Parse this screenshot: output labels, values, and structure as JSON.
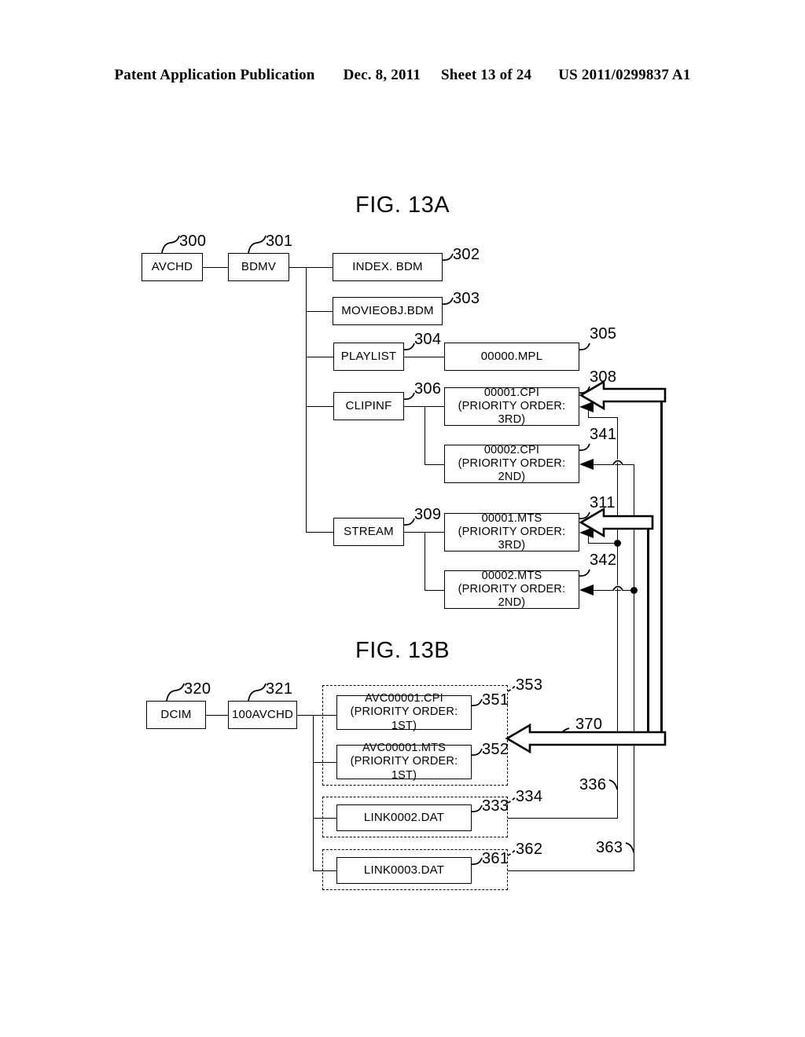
{
  "header": {
    "publication": "Patent Application Publication",
    "date": "Dec. 8, 2011",
    "sheet": "Sheet 13 of 24",
    "docnum": "US 2011/0299837 A1"
  },
  "figures": [
    {
      "id": "fig-13a",
      "title": "FIG. 13A"
    },
    {
      "id": "fig-13b",
      "title": "FIG. 13B"
    }
  ],
  "fig13a": {
    "title": "FIG. 13A",
    "nodes": [
      {
        "key": "avchd",
        "label": "AVCHD",
        "ref": "300"
      },
      {
        "key": "bdmv",
        "label": "BDMV",
        "ref": "301"
      },
      {
        "key": "index",
        "label": "INDEX. BDM",
        "ref": "302"
      },
      {
        "key": "movieobj",
        "label": "MOVIEOBJ.BDM",
        "ref": "303"
      },
      {
        "key": "playlist",
        "label": "PLAYLIST",
        "ref": "304"
      },
      {
        "key": "mpl",
        "label": "00000.MPL",
        "ref": "305"
      },
      {
        "key": "clipinf",
        "label": "CLIPINF",
        "ref": "306"
      },
      {
        "key": "cpi1",
        "label": "00001.CPI",
        "sub": "(PRIORITY ORDER: 3RD)",
        "ref": "308"
      },
      {
        "key": "cpi2",
        "label": "00002.CPI",
        "sub": "(PRIORITY ORDER: 2ND)",
        "ref": "341"
      },
      {
        "key": "stream",
        "label": "STREAM",
        "ref": "309"
      },
      {
        "key": "mts1",
        "label": "00001.MTS",
        "sub": "(PRIORITY ORDER: 3RD)",
        "ref": "311"
      },
      {
        "key": "mts2",
        "label": "00002.MTS",
        "sub": "(PRIORITY ORDER: 2ND)",
        "ref": "342"
      }
    ]
  },
  "fig13b": {
    "title": "FIG. 13B",
    "nodes": [
      {
        "key": "dcim",
        "label": "DCIM",
        "ref": "320"
      },
      {
        "key": "avchd100",
        "label": "100AVCHD",
        "ref": "321"
      },
      {
        "key": "avccpi",
        "label": "AVC00001.CPI",
        "sub": "(PRIORITY ORDER: 1ST)",
        "ref": "351"
      },
      {
        "key": "avcmts",
        "label": "AVC00001.MTS",
        "sub": "(PRIORITY ORDER: 1ST)",
        "ref": "352"
      },
      {
        "key": "link2",
        "label": "LINK0002.DAT",
        "ref": "333"
      },
      {
        "key": "link3",
        "label": "LINK0003.DAT",
        "ref": "361"
      }
    ],
    "groups": [
      {
        "key": "group-avc",
        "ref": "353"
      },
      {
        "key": "group-link2",
        "ref": "334"
      },
      {
        "key": "group-link3",
        "ref": "362"
      }
    ],
    "links": [
      {
        "key": "link-370",
        "ref": "370"
      },
      {
        "key": "link-336",
        "ref": "336"
      },
      {
        "key": "link-363",
        "ref": "363"
      }
    ]
  }
}
